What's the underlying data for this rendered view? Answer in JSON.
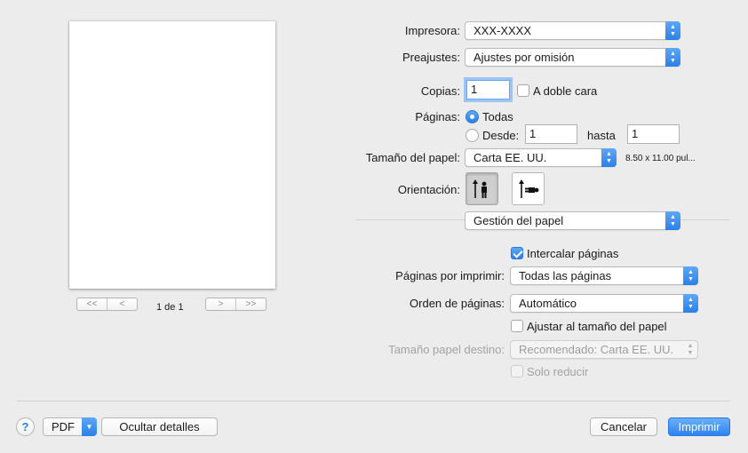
{
  "preview": {
    "page_indicator": "1 de 1",
    "nav_first": "<<",
    "nav_prev": "<",
    "nav_next": ">",
    "nav_last": ">>"
  },
  "printer": {
    "label": "Impresora:",
    "value": "XXX-XXXX"
  },
  "presets": {
    "label": "Preajustes:",
    "value": "Ajustes por omisión"
  },
  "copies": {
    "label": "Copias:",
    "value": "1",
    "duplex_label": "A doble cara",
    "duplex_checked": false
  },
  "pages": {
    "label": "Páginas:",
    "all_label": "Todas",
    "from_label": "Desde:",
    "from_value": "1",
    "to_label": "hasta",
    "to_value": "1",
    "selected": "all"
  },
  "paper_size": {
    "label": "Tamaño del papel:",
    "value": "Carta EE. UU.",
    "dimensions": "8.50 x 11.00 pul..."
  },
  "orientation": {
    "label": "Orientación:",
    "selected": "portrait"
  },
  "section": {
    "value": "Gestión del papel"
  },
  "paper_handling": {
    "collate_label": "Intercalar páginas",
    "collate_checked": true,
    "pages_to_print_label": "Páginas por imprimir:",
    "pages_to_print_value": "Todas las páginas",
    "page_order_label": "Orden de páginas:",
    "page_order_value": "Automático",
    "scale_label": "Ajustar al tamaño del papel",
    "scale_checked": false,
    "dest_size_label": "Tamaño papel destino:",
    "dest_size_value": "Recomendado: Carta EE. UU.",
    "scale_down_label": "Solo reducir",
    "scale_down_checked": false
  },
  "footer": {
    "help": "?",
    "pdf_label": "PDF",
    "hide_details_label": "Ocultar detalles",
    "cancel_label": "Cancelar",
    "print_label": "Imprimir"
  },
  "colors": {
    "accent": "#2a7fe8",
    "background": "#ececec"
  }
}
